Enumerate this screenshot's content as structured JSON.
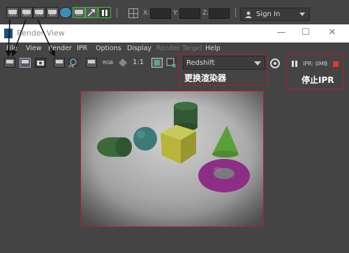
{
  "topbar": {
    "icon_labels": [
      "123",
      "123",
      "IPR",
      "123",
      "",
      "123",
      ""
    ],
    "coords": {
      "x": "X:",
      "y": "Y:",
      "z": "Z:"
    },
    "signin": "Sign In"
  },
  "window": {
    "title": "Render View"
  },
  "menu": [
    "File",
    "View",
    "Render",
    "IPR",
    "Options",
    "Display",
    "Render Target",
    "Help"
  ],
  "toolbar": {
    "icon_labels": [
      "123",
      "123",
      "",
      "123",
      "IPR",
      "123"
    ],
    "rgb": "RGB",
    "ratio": "1:1",
    "renderer": "Redshift",
    "ipr_status": "IPR: 0MB"
  },
  "annotations": {
    "renderer_label": "更换渲染器",
    "stop_label": "停止IPR"
  },
  "colors": {
    "annotation": "#b21d2c",
    "ui_dark": "#444444"
  }
}
